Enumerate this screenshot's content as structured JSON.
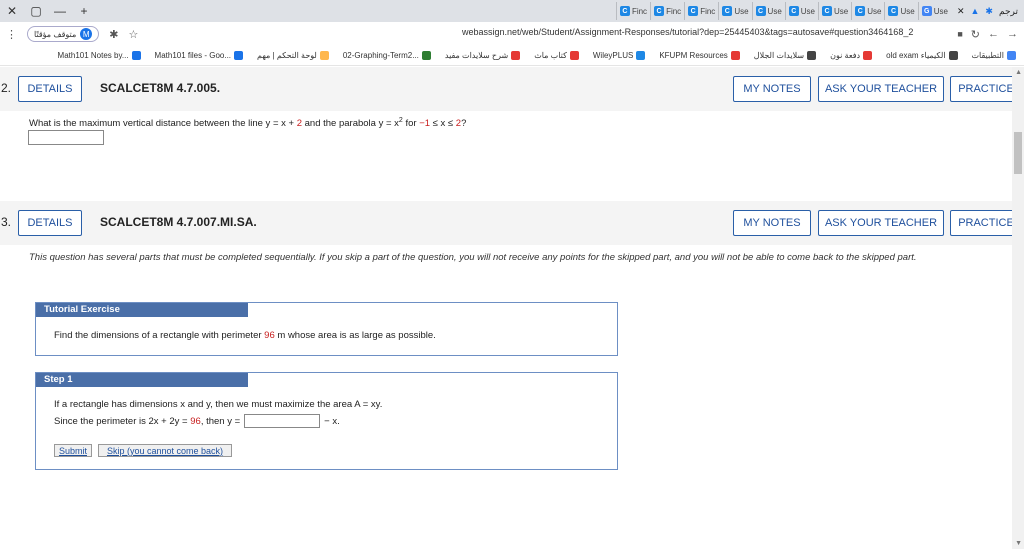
{
  "browser": {
    "tabs": [
      {
        "label": "Use",
        "fav": "G",
        "color": "#4285f4"
      },
      {
        "label": "Use",
        "fav": "C",
        "color": "#1e88e5"
      },
      {
        "label": "Use",
        "fav": "C",
        "color": "#1e88e5"
      },
      {
        "label": "Use",
        "fav": "C",
        "color": "#1e88e5"
      },
      {
        "label": "Use",
        "fav": "C",
        "color": "#1e88e5"
      },
      {
        "label": "Use",
        "fav": "C",
        "color": "#1e88e5"
      },
      {
        "label": "Use",
        "fav": "C",
        "color": "#1e88e5"
      },
      {
        "label": "Finc",
        "fav": "C",
        "color": "#1e88e5"
      },
      {
        "label": "Finc",
        "fav": "C",
        "color": "#1e88e5"
      },
      {
        "label": "Finc",
        "fav": "C",
        "color": "#1e88e5"
      }
    ],
    "url": "webassign.net/web/Student/Assignment-Responses/tutorial?dep=25445403&tags=autosave#question3464168_2",
    "profile_label": "متوقف مؤقتًا",
    "profile_initial": "M",
    "translate_label": "ترجم"
  },
  "bookmarks": [
    {
      "label": "التطبيقات",
      "color": "#4285f4"
    },
    {
      "label": "old exam الكيمياء",
      "color": "#444"
    },
    {
      "label": "دفعة نون",
      "color": "#e53935"
    },
    {
      "label": "سلايدات الجلال",
      "color": "#444"
    },
    {
      "label": "KFUPM Resources",
      "color": "#e53935"
    },
    {
      "label": "WileyPLUS",
      "color": "#1e88e5"
    },
    {
      "label": "كتاب ماث",
      "color": "#e53935"
    },
    {
      "label": "شرح سلايدات مفيد",
      "color": "#e53935"
    },
    {
      "label": "02-Graphing-Term2...",
      "color": "#2e7d32"
    },
    {
      "label": "لوحة التحكم | مهم",
      "color": "#ffb74d"
    },
    {
      "label": "Math101 files - Goo...",
      "color": "#1a73e8"
    },
    {
      "label": "Math101 Notes by...",
      "color": "#1a73e8"
    }
  ],
  "q1": {
    "number": "2.",
    "details": "DETAILS",
    "code": "SCALCET8M 4.7.005.",
    "my_notes": "MY NOTES",
    "ask": "ASK YOUR TEACHER",
    "practice": "PRACTICE",
    "text_a": "What is the maximum vertical distance between the line  y = x + ",
    "red_a": "2",
    "text_b": "  and the parabola  y = x",
    "sup": "2",
    "text_c": "  for  ",
    "red_b": "−1",
    "text_d": " ≤ x ≤ ",
    "red_c": "2",
    "text_e": "?"
  },
  "q2": {
    "number": "3.",
    "details": "DETAILS",
    "code": "SCALCET8M 4.7.007.MI.SA.",
    "my_notes": "MY NOTES",
    "ask": "ASK YOUR TEACHER",
    "practice": "PRACTICE",
    "intro": "This question has several parts that must be completed sequentially. If you skip a part of the question, you will not receive any points for the skipped part, and you will not be able to come back to the skipped part.",
    "tutorial_title": "Tutorial Exercise",
    "tutorial_a": "Find the dimensions of a rectangle with perimeter ",
    "tutorial_red": "96",
    "tutorial_b": " m whose area is as large as possible.",
    "step_title": "Step 1",
    "step_l1": "If a rectangle has dimensions x and y, then we must maximize the area  A = xy.",
    "step_l2a": "Since the perimeter is  2x + 2y = ",
    "step_red": "96",
    "step_l2b": ",  then  y =",
    "step_l2c": "− x.",
    "submit": "Submit",
    "skip": "Skip (you cannot come back)"
  }
}
